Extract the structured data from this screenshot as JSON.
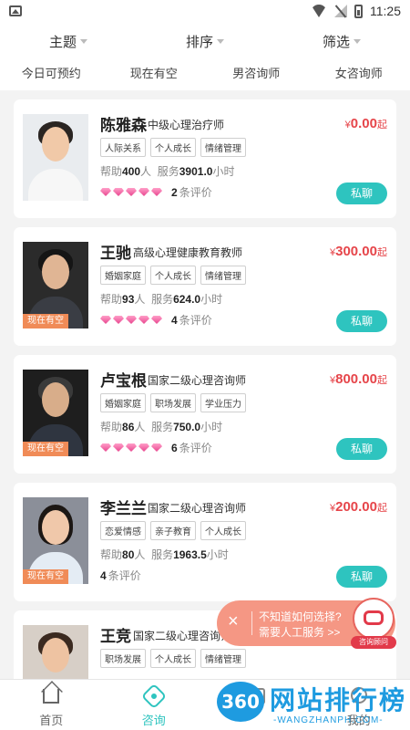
{
  "status_bar": {
    "time": "11:25"
  },
  "filters": [
    {
      "label": "主题"
    },
    {
      "label": "排序"
    },
    {
      "label": "筛选"
    }
  ],
  "quick_filters": [
    {
      "label": "今日可预约"
    },
    {
      "label": "现在有空"
    },
    {
      "label": "男咨询师"
    },
    {
      "label": "女咨询师"
    }
  ],
  "counselors": [
    {
      "name": "陈雅森",
      "title": "中级心理治疗师",
      "yen": "¥",
      "price": "0.00",
      "price_suffix": "起",
      "tags": [
        "人际关系",
        "个人成长",
        "情绪管理"
      ],
      "help_label": "帮助",
      "help_count": "400",
      "help_unit": "人",
      "service_label": "服务",
      "service_hours": "3901.0",
      "service_unit": "小时",
      "gems": 5,
      "review_count": "2",
      "review_label": "条评价",
      "now_available": "",
      "chat_label": "私聊"
    },
    {
      "name": "王驰",
      "title": "高级心理健康教育教师",
      "yen": "¥",
      "price": "300.00",
      "price_suffix": "起",
      "tags": [
        "婚姻家庭",
        "个人成长",
        "情绪管理"
      ],
      "help_label": "帮助",
      "help_count": "93",
      "help_unit": "人",
      "service_label": "服务",
      "service_hours": "624.0",
      "service_unit": "小时",
      "gems": 5,
      "review_count": "4",
      "review_label": "条评价",
      "now_available": "现在有空",
      "chat_label": "私聊"
    },
    {
      "name": "卢宝根",
      "title": "国家二级心理咨询师",
      "yen": "¥",
      "price": "800.00",
      "price_suffix": "起",
      "tags": [
        "婚姻家庭",
        "职场发展",
        "学业压力"
      ],
      "help_label": "帮助",
      "help_count": "86",
      "help_unit": "人",
      "service_label": "服务",
      "service_hours": "750.0",
      "service_unit": "小时",
      "gems": 5,
      "review_count": "6",
      "review_label": "条评价",
      "now_available": "现在有空",
      "chat_label": "私聊"
    },
    {
      "name": "李兰兰",
      "title": "国家二级心理咨询师",
      "yen": "¥",
      "price": "200.00",
      "price_suffix": "起",
      "tags": [
        "恋爱情感",
        "亲子教育",
        "个人成长"
      ],
      "help_label": "帮助",
      "help_count": "80",
      "help_unit": "人",
      "service_label": "服务",
      "service_hours": "1963.5",
      "service_unit": "小时",
      "gems": 0,
      "review_count": "4",
      "review_label": "条评价",
      "now_available": "现在有空",
      "chat_label": "私聊"
    },
    {
      "name": "王竞",
      "title": "国家二级心理咨询师",
      "yen": "",
      "price": "",
      "price_suffix": "",
      "tags": [
        "职场发展",
        "个人成长",
        "情绪管理"
      ],
      "help_label": "",
      "help_count": "",
      "help_unit": "",
      "service_label": "",
      "service_hours": "",
      "service_unit": "",
      "gems": 0,
      "review_count": "",
      "review_label": "",
      "now_available": "",
      "chat_label": ""
    }
  ],
  "help_float": {
    "close": "×",
    "line1": "不知道如何选择?",
    "line2": "需要人工服务 >>",
    "advisor_label": "咨询顾问"
  },
  "tabs": [
    {
      "label": "首页",
      "icon": "home-icon"
    },
    {
      "label": "咨询",
      "icon": "consult-icon",
      "active": true
    },
    {
      "label": "",
      "icon": "course-icon"
    },
    {
      "label": "我的",
      "icon": "me-icon"
    }
  ],
  "watermark": {
    "logo_text": "360",
    "title": "网站排行榜",
    "subtitle": "-WANGZHANPH.COM-"
  },
  "colors": {
    "accent": "#2ec4bf",
    "price": "#e6454a",
    "badge": "#f08b57"
  }
}
